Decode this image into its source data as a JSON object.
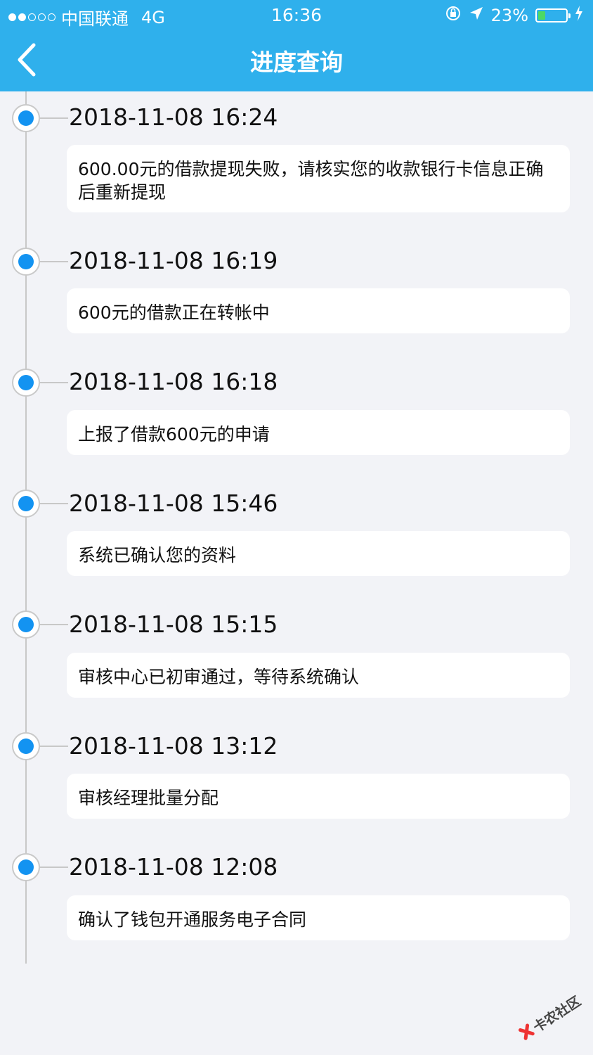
{
  "status_bar": {
    "carrier": "中国联通",
    "network": "4G",
    "time": "16:36",
    "battery": "23%",
    "battery_level": 0.23
  },
  "nav": {
    "title": "进度查询",
    "back_icon": "chevron-left-icon"
  },
  "events": [
    {
      "datetime": "2018-11-08 16:24",
      "message": "600.00元的借款提现失败，请核实您的收款银行卡信息正确后重新提现"
    },
    {
      "datetime": "2018-11-08 16:19",
      "message": "600元的借款正在转帐中"
    },
    {
      "datetime": "2018-11-08 16:18",
      "message": "上报了借款600元的申请"
    },
    {
      "datetime": "2018-11-08 15:46",
      "message": "系统已确认您的资料"
    },
    {
      "datetime": "2018-11-08 15:15",
      "message": "审核中心已初审通过，等待系统确认"
    },
    {
      "datetime": "2018-11-08 13:12",
      "message": "审核经理批量分配"
    },
    {
      "datetime": "2018-11-08 12:08",
      "message": "确认了钱包开通服务电子合同"
    }
  ],
  "watermark": {
    "text": "卡农社区"
  },
  "colors": {
    "header": "#2fb0ec",
    "node": "#1393f1",
    "background": "#f2f3f7"
  }
}
